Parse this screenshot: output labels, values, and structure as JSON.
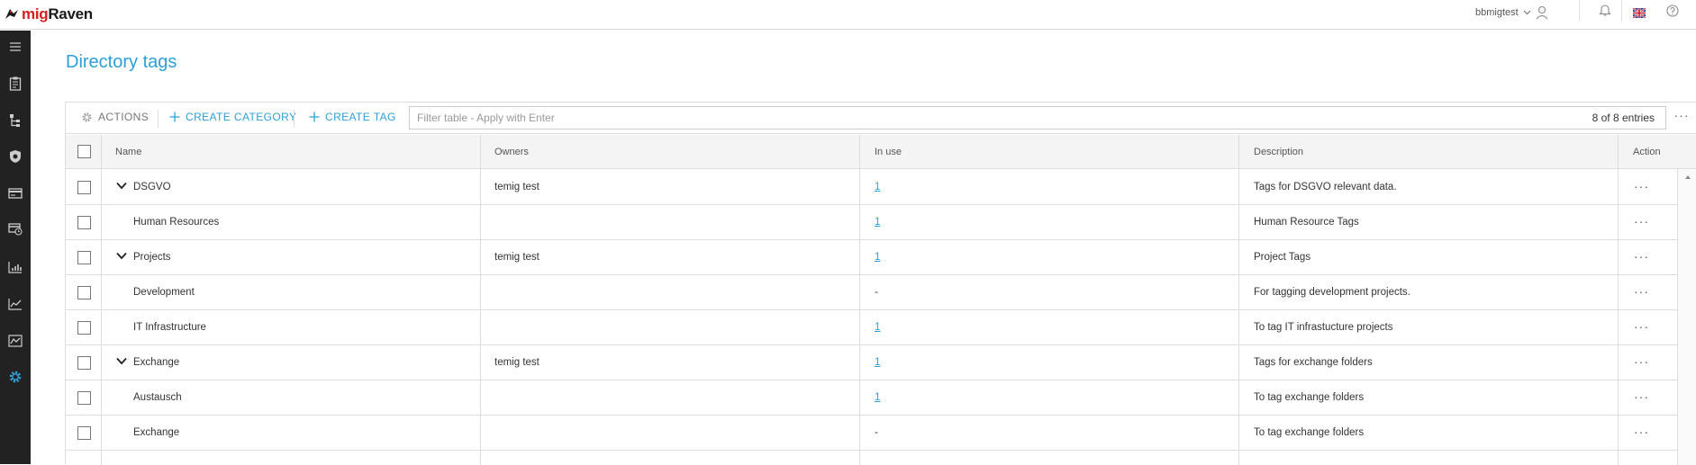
{
  "app": {
    "logo_prefix": "mig",
    "logo_suffix": "Raven",
    "username": "bbmigtest"
  },
  "page": {
    "title": "Directory tags"
  },
  "toolbar": {
    "actions_label": "ACTIONS",
    "create_category_label": "CREATE CATEGORY",
    "create_tag_label": "CREATE TAG",
    "filter_placeholder": "Filter table - Apply with Enter",
    "entries_count": "8 of 8 entries"
  },
  "columns": {
    "name": "Name",
    "owners": "Owners",
    "in_use": "In use",
    "description": "Description",
    "action": "Action"
  },
  "rows": [
    {
      "name": "DSGVO",
      "owners": "temig test",
      "in_use": "1",
      "description": "Tags for DSGVO relevant data.",
      "is_category": true
    },
    {
      "name": "Human Resources",
      "owners": "",
      "in_use": "1",
      "description": "Human Resource Tags",
      "is_category": false
    },
    {
      "name": "Projects",
      "owners": "temig test",
      "in_use": "1",
      "description": "Project Tags",
      "is_category": true
    },
    {
      "name": "Development",
      "owners": "",
      "in_use": "-",
      "description": "For tagging development projects.",
      "is_category": false
    },
    {
      "name": "IT Infrastructure",
      "owners": "",
      "in_use": "1",
      "description": "To tag IT infrastucture projects",
      "is_category": false
    },
    {
      "name": "Exchange",
      "owners": "temig test",
      "in_use": "1",
      "description": "Tags for exchange folders",
      "is_category": true
    },
    {
      "name": "Austausch",
      "owners": "",
      "in_use": "1",
      "description": "To tag exchange folders",
      "is_category": false
    },
    {
      "name": "Exchange",
      "owners": "",
      "in_use": "-",
      "description": "To tag exchange folders",
      "is_category": false
    }
  ],
  "sidebar": {
    "items": [
      {
        "icon": "menu-icon"
      },
      {
        "icon": "clipboard-icon"
      },
      {
        "icon": "tree-icon"
      },
      {
        "icon": "shield-icon"
      },
      {
        "icon": "card-icon"
      },
      {
        "icon": "storage-clock-icon"
      },
      {
        "icon": "bar-chart-icon"
      },
      {
        "icon": "line-chart-icon"
      },
      {
        "icon": "activity-chart-icon"
      },
      {
        "icon": "gear-icon",
        "active": true
      }
    ]
  },
  "colors": {
    "accent": "#2e9fd6",
    "sidebar": "#222222",
    "logo_red": "#d32020"
  }
}
